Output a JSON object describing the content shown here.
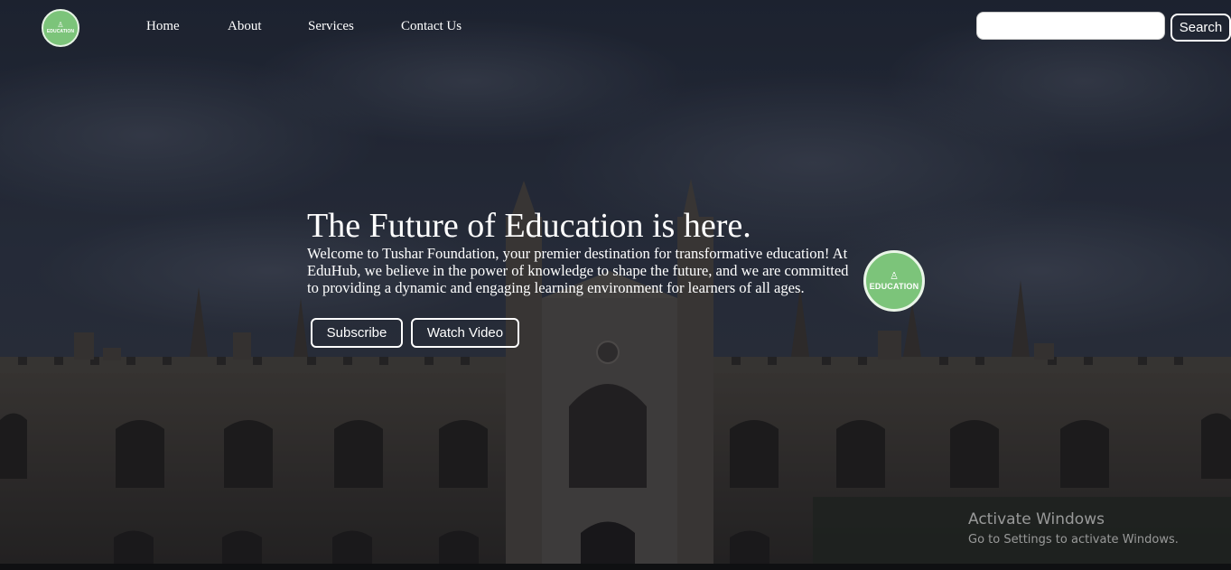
{
  "logo": {
    "text": "EDUCATION",
    "icon": "education-icon"
  },
  "nav": {
    "links": [
      "Home",
      "About",
      "Services",
      "Contact Us"
    ]
  },
  "search": {
    "value": "",
    "placeholder": "",
    "button_label": "Search"
  },
  "hero": {
    "title": "The Future of Education is here.",
    "text": "Welcome to Tushar Foundation, your premier destination for transformative education! At EduHub, we believe in the power of knowledge to shape the future, and we are committed to providing a dynamic and engaging learning environment for learners of all ages.",
    "subscribe_label": "Subscribe",
    "watch_label": "Watch Video"
  },
  "badge": {
    "text": "EDUCATION",
    "icon": "education-icon"
  },
  "watermark": {
    "title": "Activate Windows",
    "subtitle": "Go to Settings to activate Windows."
  },
  "colors": {
    "logo_green": "#7cc47a",
    "overlay": "#1b2130",
    "text": "#ffffff"
  }
}
